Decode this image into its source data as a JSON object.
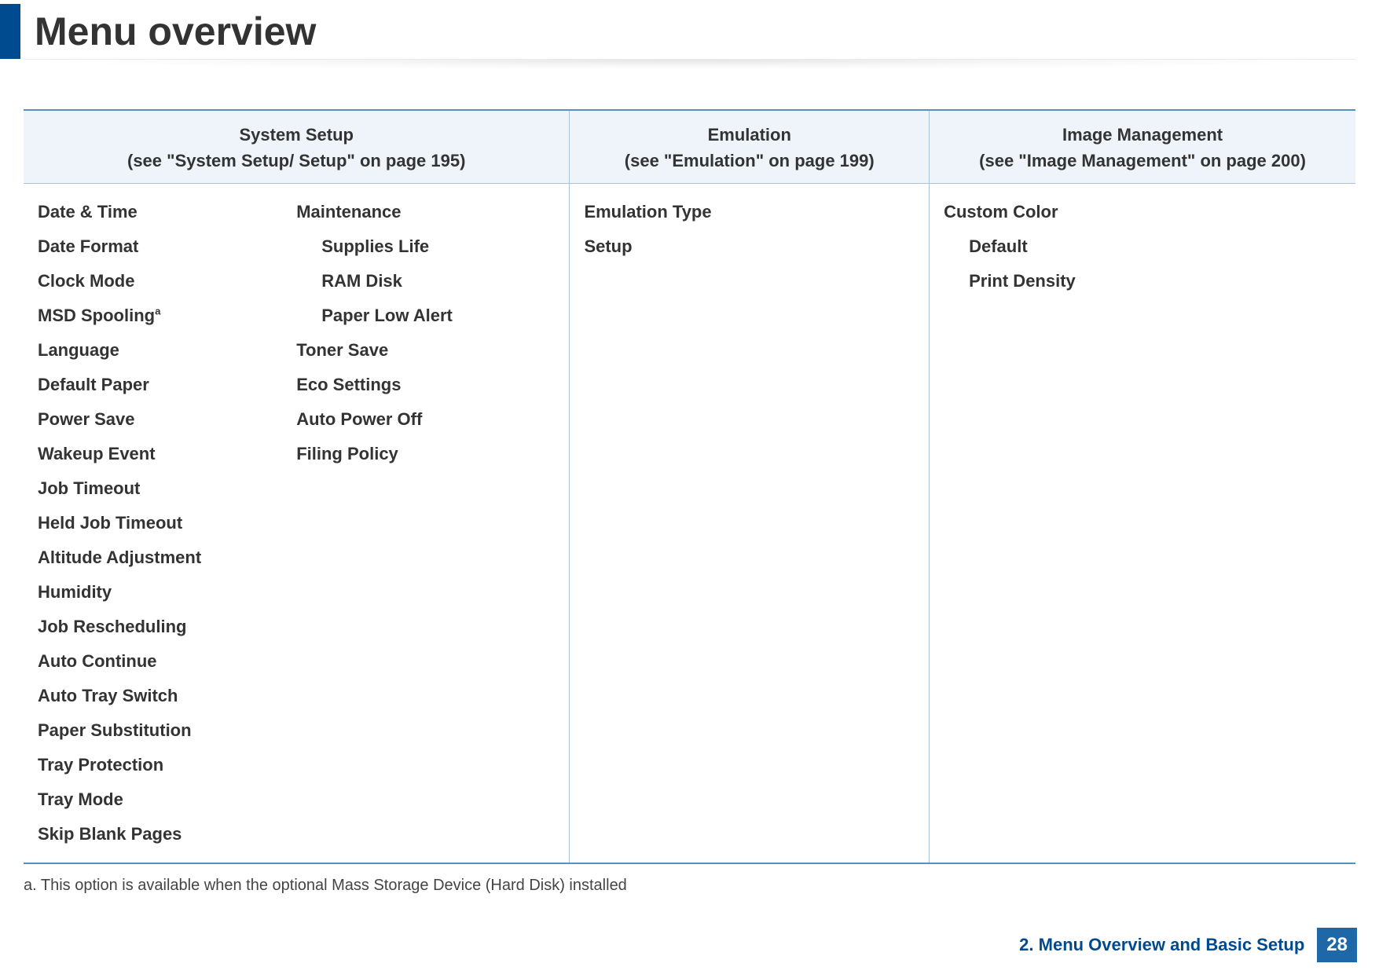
{
  "page_title": "Menu overview",
  "columns": [
    {
      "title": "System Setup",
      "subtitle": "(see \"System Setup/ Setup\" on page 195)"
    },
    {
      "title": "Emulation",
      "subtitle": "(see \"Emulation\" on page 199)"
    },
    {
      "title": "Image Management",
      "subtitle": "(see \"Image Management\" on page 200)"
    }
  ],
  "system_setup": {
    "col1": [
      "Date & Time",
      "Date Format",
      "Clock Mode",
      "MSD Spooling",
      "Language",
      "Default Paper",
      "Power Save",
      "Wakeup Event",
      "Job Timeout",
      "Held Job Timeout",
      "Altitude Adjustment",
      "Humidity",
      "Job Rescheduling",
      "Auto Continue",
      "Auto Tray Switch",
      "Paper Substitution",
      "Tray Protection",
      "Tray Mode",
      "Skip Blank Pages"
    ],
    "col2": {
      "maintenance": "Maintenance",
      "maintenance_sub": [
        "Supplies Life",
        "RAM Disk",
        "Paper Low Alert"
      ],
      "rest": [
        "Toner Save",
        "Eco Settings",
        "Auto Power Off",
        "Filing Policy"
      ]
    },
    "footnote_marker": "a"
  },
  "emulation": [
    "Emulation Type",
    "Setup"
  ],
  "image_management": {
    "custom_color": "Custom Color",
    "sub": [
      "Default",
      "Print Density"
    ]
  },
  "footnote": {
    "marker": "a.",
    "text": "This option is available when the optional Mass Storage Device (Hard Disk) installed"
  },
  "footer": {
    "chapter": "2. Menu Overview and Basic Setup",
    "page": "28"
  }
}
